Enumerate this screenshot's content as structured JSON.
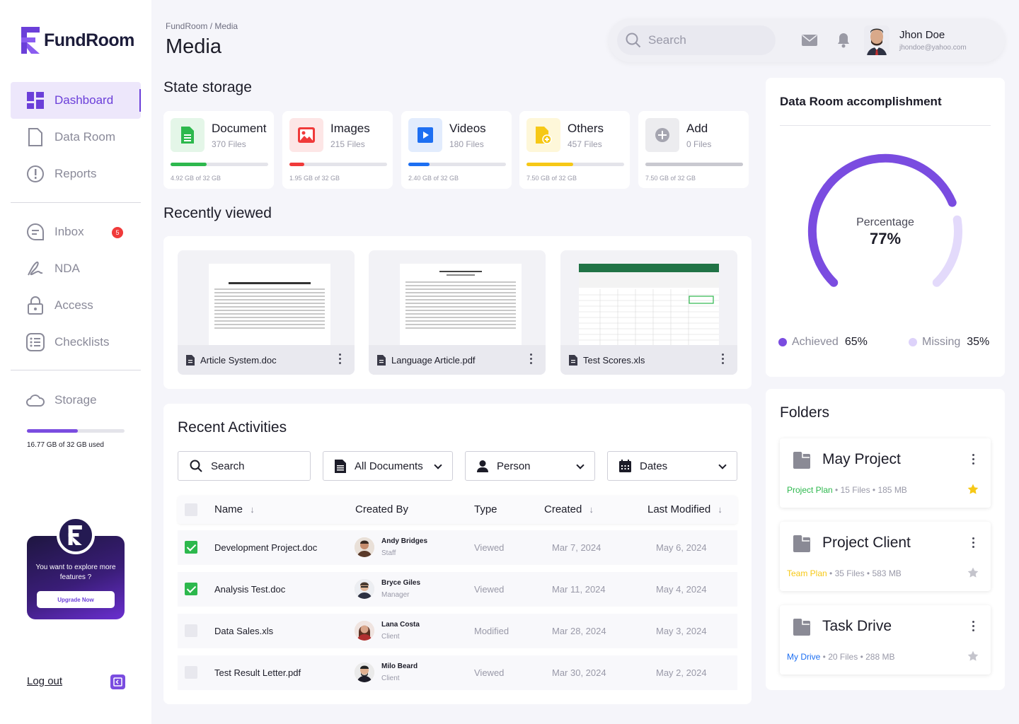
{
  "app": {
    "name": "FundRoom"
  },
  "sidebar": {
    "items": [
      {
        "label": "Dashboard",
        "active": true,
        "icon": "dashboard-icon"
      },
      {
        "label": "Data Room",
        "icon": "file-icon"
      },
      {
        "label": "Reports",
        "icon": "alert-circle-icon"
      },
      {
        "label": "Inbox",
        "icon": "chat-icon",
        "badge": "5"
      },
      {
        "label": "NDA",
        "icon": "signature-icon"
      },
      {
        "label": "Access",
        "icon": "lock-icon"
      },
      {
        "label": "Checklists",
        "icon": "checklist-icon"
      },
      {
        "label": "Storage",
        "icon": "cloud-icon"
      }
    ],
    "storage_used_text": "16.77 GB of 32 GB used",
    "storage_fraction": 0.52,
    "promo": {
      "text": "You want to explore more features ?",
      "button": "Upgrade Now"
    },
    "logout": "Log out"
  },
  "header": {
    "breadcrumb": "FundRoom / Media",
    "title": "Media",
    "search_placeholder": "Search",
    "user": {
      "name": "Jhon Doe",
      "email": "jhondoe@yahoo.com"
    }
  },
  "state_storage": {
    "title": "State storage",
    "cards": [
      {
        "name": "Document",
        "count": "370 Files",
        "size": "4.92 GB of 32 GB",
        "fill": 0.37,
        "color": "#2db84d",
        "bg": "#e4f6e8"
      },
      {
        "name": "Images",
        "count": "215 Files",
        "size": "1.95 GB of 32 GB",
        "fill": 0.15,
        "color": "#f03a3a",
        "bg": "#fde6e6"
      },
      {
        "name": "Videos",
        "count": "180 Files",
        "size": "2.40 GB of 32 GB",
        "fill": 0.22,
        "color": "#1d6ff2",
        "bg": "#e2ecfd"
      },
      {
        "name": "Others",
        "count": "457 Files",
        "size": "7.50 GB of 32 GB",
        "fill": 0.48,
        "color": "#f6c816",
        "bg": "#fef7d9"
      },
      {
        "name": "Add",
        "count": "0 Files",
        "size": "7.50 GB of 32 GB",
        "fill": 1.0,
        "color": "#c9c9d0",
        "bg": "#ececef"
      }
    ]
  },
  "recently_viewed": {
    "title": "Recently viewed",
    "files": [
      {
        "name": "Article System.doc"
      },
      {
        "name": "Language Article.pdf"
      },
      {
        "name": "Test Scores.xls"
      }
    ]
  },
  "activities": {
    "title": "Recent Activities",
    "filters": {
      "search": "Search",
      "documents": "All Documents",
      "person": "Person",
      "dates": "Dates"
    },
    "columns": [
      "Name",
      "Created By",
      "Type",
      "Created",
      "Last Modified"
    ],
    "rows": [
      {
        "checked": true,
        "name": "Development Project.doc",
        "person": "Andy Bridges",
        "role": "Staff",
        "type": "Viewed",
        "created": "Mar 7, 2024",
        "modified": "May 6, 2024"
      },
      {
        "checked": true,
        "name": "Analysis Test.doc",
        "person": "Bryce Giles",
        "role": "Manager",
        "type": "Viewed",
        "created": "Mar 11, 2024",
        "modified": "May 4, 2024"
      },
      {
        "checked": false,
        "name": "Data Sales.xls",
        "person": "Lana Costa",
        "role": "Client",
        "type": "Modified",
        "created": "Mar 28, 2024",
        "modified": "May 3, 2024"
      },
      {
        "checked": false,
        "name": "Test Result Letter.pdf",
        "person": "Milo Beard",
        "role": "Client",
        "type": "Viewed",
        "created": "Mar 30, 2024",
        "modified": "May 2, 2024"
      }
    ]
  },
  "accomplishment": {
    "title": "Data Room accomplishment",
    "center_label": "Percentage",
    "center_value": "77%",
    "progress": 0.77,
    "legend": [
      {
        "label": "Achieved",
        "value": "65%",
        "color": "#7a4ce0"
      },
      {
        "label": "Missing",
        "value": "35%",
        "color": "#ddd2fa"
      }
    ]
  },
  "folders": {
    "title": "Folders",
    "items": [
      {
        "name": "May Project",
        "plan": "Project Plan",
        "plan_color": "#2db84d",
        "meta": " • 15 Files • 185 MB",
        "starred": true
      },
      {
        "name": "Project Client",
        "plan": "Team Plan",
        "plan_color": "#f6c816",
        "meta": " • 35 Files • 583 MB",
        "starred": false
      },
      {
        "name": "Task Drive",
        "plan": "My Drive",
        "plan_color": "#1d6ff2",
        "meta": " • 20 Files • 288 MB",
        "starred": false
      }
    ]
  }
}
